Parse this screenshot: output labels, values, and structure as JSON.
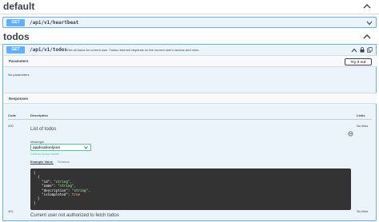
{
  "default_section": {
    "title": "default"
  },
  "heartbeat_op": {
    "method": "GET",
    "path": "/api/v1/heartbeat"
  },
  "todos_section": {
    "title": "todos"
  },
  "todos_op": {
    "method": "GET",
    "path": "/api/v1/todos",
    "summary": "Get all todos for current user. Todos returned depends on the current user's access and roles."
  },
  "parameters": {
    "header": "Parameters",
    "try_button": "Try it out",
    "empty_text": "No parameters"
  },
  "responses": {
    "header": "Responses",
    "col_code": "Code",
    "col_description": "Description",
    "col_links": "Links",
    "rows": [
      {
        "code": "200",
        "description": "List of todos",
        "links": "No links",
        "media_type_label": "Media type",
        "media_type_value": "application/json",
        "accept_note": "Controls Accept header.",
        "tab_example": "Example Value",
        "tab_schema": "Schema",
        "example_lines": [
          "[",
          "  {",
          "    \"id\": \"string\",",
          "    \"name\": \"string\",",
          "    \"description\": \"string\",",
          "    \"isCompleted\": true",
          "  }",
          "]"
        ]
      },
      {
        "code": "401",
        "description": "Current user not authorized to fetch todos",
        "links": "No links"
      }
    ]
  },
  "colors": {
    "get_blue": "#61affe",
    "get_bg": "#ecf4fb",
    "success_green": "#49cc90",
    "code_bg": "#333333"
  },
  "icons": [
    "chevron-up-icon",
    "chevron-down-icon",
    "lock-icon",
    "copy-icon"
  ]
}
